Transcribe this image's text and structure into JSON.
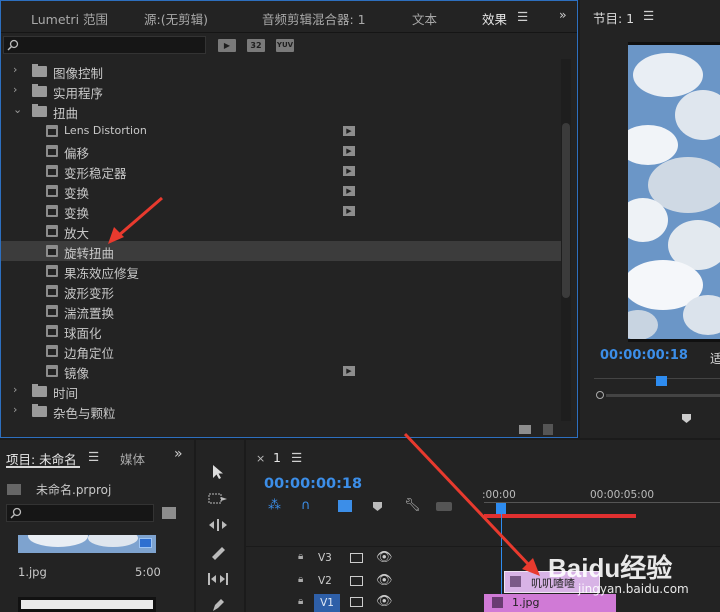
{
  "effects_panel": {
    "tabs": [
      "Lumetri 范围",
      "源:(无剪辑)",
      "音频剪辑混合器: 1",
      "文本",
      "效果"
    ],
    "active_tab": "效果",
    "filter_buttons": [
      "32",
      "YUV"
    ],
    "tree": [
      {
        "type": "folder",
        "label": "图像控制",
        "open": false
      },
      {
        "type": "folder",
        "label": "实用程序",
        "open": false
      },
      {
        "type": "folder",
        "label": "扭曲",
        "open": true
      },
      {
        "type": "effect",
        "label": "Lens Distortion",
        "accel": true
      },
      {
        "type": "effect",
        "label": "偏移",
        "accel": true
      },
      {
        "type": "effect",
        "label": "变形稳定器",
        "accel": true
      },
      {
        "type": "effect",
        "label": "变换",
        "accel": true
      },
      {
        "type": "effect",
        "label": "变换",
        "accel": true
      },
      {
        "type": "effect",
        "label": "放大",
        "accel": false
      },
      {
        "type": "effect",
        "label": "旋转扭曲",
        "accel": false,
        "selected": true
      },
      {
        "type": "effect",
        "label": "果冻效应修复",
        "accel": false
      },
      {
        "type": "effect",
        "label": "波形变形",
        "accel": false
      },
      {
        "type": "effect",
        "label": "湍流置换",
        "accel": false
      },
      {
        "type": "effect",
        "label": "球面化",
        "accel": false
      },
      {
        "type": "effect",
        "label": "边角定位",
        "accel": false
      },
      {
        "type": "effect",
        "label": "镜像",
        "accel": true
      },
      {
        "type": "folder",
        "label": "时间",
        "open": false
      },
      {
        "type": "folder",
        "label": "杂色与颗粒",
        "open": false
      }
    ]
  },
  "program_monitor": {
    "title": "节目: 1",
    "timecode": "00:00:00:18",
    "fit_label": "适"
  },
  "project_panel": {
    "tab": "项目: 未命名",
    "tab2": "媒体",
    "file": "未命名.prproj",
    "clip_name": "1.jpg",
    "clip_duration": "5:00"
  },
  "timeline": {
    "sequence": "1",
    "timecode": "00:00:00:18",
    "ruler": [
      ":00:00",
      "00:00:05:00"
    ],
    "tracks": [
      "V3",
      "V2",
      "V1"
    ],
    "clips": [
      {
        "track": "V2",
        "label": "叽叽喳喳"
      },
      {
        "track": "V1",
        "label": "1.jpg"
      }
    ]
  },
  "watermark": {
    "brand": "Baidu经验",
    "url": "jingyan.baidu.com"
  },
  "colors": {
    "accent": "#2d6fbf",
    "timecode": "#3c8ee8",
    "clip_v2": "#d8b3e6",
    "clip_v1": "#d07ad6",
    "playhead": "#2e8cf0",
    "arrow": "#e83a2e"
  }
}
